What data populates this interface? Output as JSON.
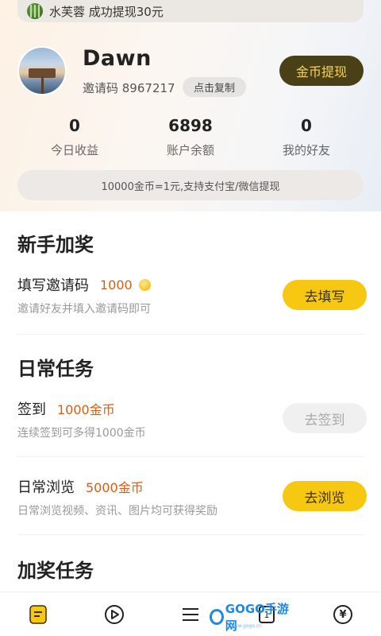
{
  "ticker": {
    "text": "水芙蓉 成功提现30元"
  },
  "profile": {
    "username": "Dawn",
    "invite_label": "邀请码 8967217",
    "copy_label": "点击复制",
    "withdraw_label": "金币提现"
  },
  "stats": [
    {
      "value": "0",
      "label": "今日收益"
    },
    {
      "value": "6898",
      "label": "账户余额"
    },
    {
      "value": "0",
      "label": "我的好友"
    }
  ],
  "rate_text": "10000金币=1元,支持支付宝/微信提现",
  "sections": {
    "newbie": {
      "title": "新手加奖",
      "task": {
        "name": "填写邀请码",
        "reward": "1000",
        "desc": "邀请好友并填入邀请码即可",
        "action": "去填写"
      }
    },
    "daily": {
      "title": "日常任务",
      "tasks": [
        {
          "name": "签到",
          "reward": "1000金币",
          "desc": "连续签到可多得1000金币",
          "action": "去签到"
        },
        {
          "name": "日常浏览",
          "reward": "5000金币",
          "desc": "日常浏览视频、资讯、图片均可获得奖励",
          "action": "去浏览"
        }
      ]
    },
    "bonus": {
      "title": "加奖任务"
    }
  },
  "tabbar": {
    "icons": [
      "task-tab-icon",
      "play-tab-icon",
      "menu-tab-icon",
      "page-tab-icon",
      "yuan-tab-icon"
    ],
    "page_tab_text": "1",
    "yuan_tab_text": "¥"
  },
  "watermark": {
    "text": "GOGO手游网",
    "sub": "www.gogo.cn"
  },
  "colors": {
    "accent_yellow": "#f6c812",
    "reward_orange": "#d0601b",
    "withdraw_bg": "#4a4018",
    "withdraw_text": "#f4d35a"
  }
}
